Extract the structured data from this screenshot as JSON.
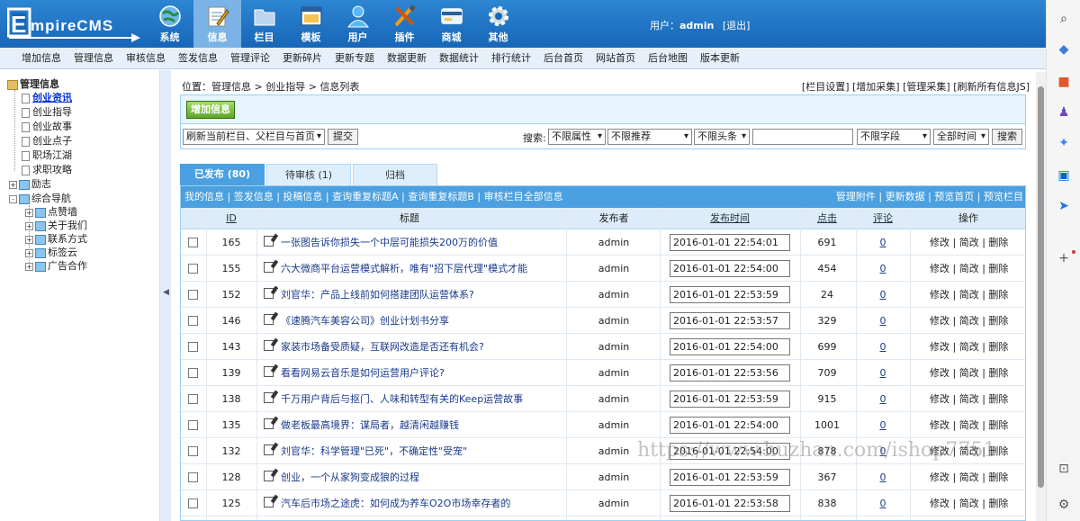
{
  "header": {
    "logo_text": "EmpireCMS",
    "nav": [
      {
        "label": "系统",
        "icon": "globe-icon"
      },
      {
        "label": "信息",
        "icon": "notepad-icon"
      },
      {
        "label": "栏目",
        "icon": "folder-icon"
      },
      {
        "label": "模板",
        "icon": "window-icon"
      },
      {
        "label": "用户",
        "icon": "user-icon"
      },
      {
        "label": "插件",
        "icon": "tools-icon"
      },
      {
        "label": "商城",
        "icon": "shop-icon"
      },
      {
        "label": "其他",
        "icon": "gear-icon"
      }
    ],
    "active_nav": "信息",
    "user_label": "用户：",
    "user_name": "admin",
    "logout": "[退出]"
  },
  "submenu": [
    "增加信息",
    "管理信息",
    "审核信息",
    "签发信息",
    "管理评论",
    "更新碎片",
    "更新专题",
    "数据更新",
    "数据统计",
    "排行统计",
    "后台首页",
    "网站首页",
    "后台地图",
    "版本更新"
  ],
  "sidebar": {
    "root": "管理信息",
    "group1": [
      {
        "label": "创业资讯",
        "active": true
      },
      {
        "label": "创业指导"
      },
      {
        "label": "创业故事"
      },
      {
        "label": "创业点子"
      },
      {
        "label": "职场江湖"
      },
      {
        "label": "求职攻略"
      }
    ],
    "lizhi": "励志",
    "zonghe": "综合导航",
    "group2": [
      "点赞墙",
      "关于我们",
      "联系方式",
      "标签云",
      "广告合作"
    ]
  },
  "breadcrumb": {
    "prefix": "位置：",
    "items": [
      "管理信息",
      "创业指导",
      "信息列表"
    ],
    "sep": " > "
  },
  "top_links": [
    "[栏目设置]",
    "[增加采集]",
    "[管理采集]",
    "[刷新所有信息JS]"
  ],
  "add_button": "增加信息",
  "refresh_select": "刷新当前栏目、父栏目与首页",
  "submit_button": "提交",
  "search": {
    "label": "搜索:",
    "attr": "不限属性",
    "recommend": "不限推荐",
    "headline": "不限头条",
    "field": "不限字段",
    "time": "全部时间",
    "button": "搜索"
  },
  "tabs": [
    {
      "label": "已发布 (80)",
      "active": true
    },
    {
      "label": "待审核 (1)"
    },
    {
      "label": "归档"
    }
  ],
  "toolbar": {
    "left": "我的信息 | 签发信息 | 投稿信息 | 查询重复标题A | 查询重复标题B | 审核栏目全部信息",
    "right": "管理附件 | 更新数据 | 预览首页 | 预览栏目"
  },
  "columns": {
    "id": "ID",
    "title": "标题",
    "publisher": "发布者",
    "time": "发布时间",
    "clicks": "点击",
    "comments": "评论",
    "ops": "操作"
  },
  "ops": "修改 | 简改 | 删除",
  "rows": [
    {
      "id": "165",
      "title": "一张图告诉你损失一个中层可能损失200万的价值",
      "pub": "admin",
      "time": "2016-01-01 22:54:01",
      "clicks": "691",
      "comments": "0"
    },
    {
      "id": "155",
      "title": "六大微商平台运营模式解析，唯有\"招下层代理\"模式才能",
      "pub": "admin",
      "time": "2016-01-01 22:54:00",
      "clicks": "454",
      "comments": "0"
    },
    {
      "id": "152",
      "title": "刘官华：产品上线前如何搭建团队运营体系?",
      "pub": "admin",
      "time": "2016-01-01 22:53:59",
      "clicks": "24",
      "comments": "0"
    },
    {
      "id": "146",
      "title": "《速腾汽车美容公司》创业计划书分享",
      "pub": "admin",
      "time": "2016-01-01 22:53:57",
      "clicks": "329",
      "comments": "0"
    },
    {
      "id": "143",
      "title": "家装市场备受质疑，互联网改造是否还有机会?",
      "pub": "admin",
      "time": "2016-01-01 22:54:00",
      "clicks": "699",
      "comments": "0"
    },
    {
      "id": "139",
      "title": "看看网易云音乐是如何运营用户评论?",
      "pub": "admin",
      "time": "2016-01-01 22:53:56",
      "clicks": "709",
      "comments": "0"
    },
    {
      "id": "138",
      "title": "千万用户背后与抠门、人味和转型有关的Keep运营故事",
      "pub": "admin",
      "time": "2016-01-01 22:53:59",
      "clicks": "915",
      "comments": "0"
    },
    {
      "id": "135",
      "title": "做老板最高境界：谋局者，越清闲越赚钱",
      "pub": "admin",
      "time": "2016-01-01 22:54:00",
      "clicks": "1001",
      "comments": "0"
    },
    {
      "id": "132",
      "title": "刘官华：科学管理\"已死\"，不确定性\"受宠\"",
      "pub": "admin",
      "time": "2016-01-01 22:54:00",
      "clicks": "878",
      "comments": "0"
    },
    {
      "id": "128",
      "title": "创业，一个从家狗变成狼的过程",
      "pub": "admin",
      "time": "2016-01-01 22:53:59",
      "clicks": "367",
      "comments": "0"
    },
    {
      "id": "125",
      "title": "汽车后市场之途虎：如何成为养车O2O市场幸存者的",
      "pub": "admin",
      "time": "2016-01-01 22:53:58",
      "clicks": "838",
      "comments": "0"
    }
  ],
  "watermark": "https://www.huzhan.com/ishop7751",
  "right_sidebar_icons": [
    "search-icon",
    "tag-icon",
    "briefcase-icon",
    "chess-icon",
    "copilot-icon",
    "outlook-icon",
    "send-icon",
    "add-icon",
    "screenshot-icon",
    "settings-icon"
  ]
}
